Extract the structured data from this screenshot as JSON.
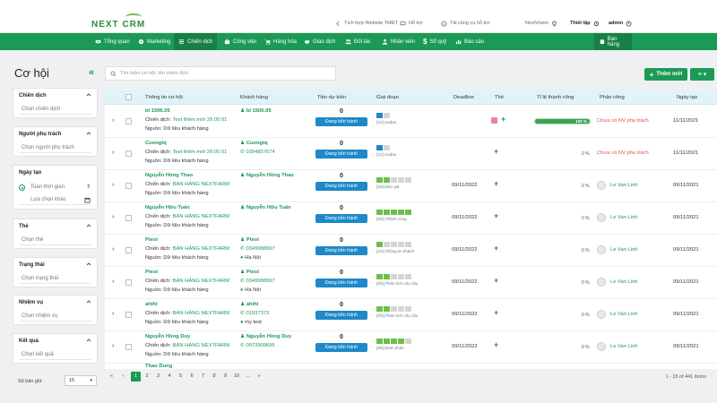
{
  "brand": {
    "name": "NEXT CRM"
  },
  "topbar": {
    "link1": "Tích hợp Website TMĐT",
    "link2": "Hỗ trợ",
    "link3": "Tải công cụ hỗ trợ",
    "org": "NextVision",
    "settings": "Thiết lập",
    "user": "admin"
  },
  "nav": [
    "Tổng quan",
    "Marketing",
    "Chiến dịch",
    "Công việc",
    "Hàng hóa",
    "Giao dịch",
    "Đối tác",
    "Nhân viên",
    "Sổ quỹ",
    "Báo cáo"
  ],
  "nav_right": "Bán hàng",
  "page": {
    "title": "Cơ hội"
  },
  "search": {
    "placeholder": "Tìm kiếm cơ hội, tên chiến dịch"
  },
  "actions": {
    "add": "Thêm mới",
    "menu": "≡ ▾"
  },
  "filters": {
    "campaign": {
      "title": "Chiến dịch",
      "placeholder": "Chọn chiến dịch"
    },
    "owner": {
      "title": "Người phụ trách",
      "placeholder": "Chọn người phụ trách"
    },
    "created": {
      "title": "Ngày tạo",
      "opt_all": "Toàn thời gian",
      "opt_custom": "Lựa chọn khác"
    },
    "tags": {
      "title": "Thẻ",
      "placeholder": "Chọn thẻ"
    },
    "status": {
      "title": "Trạng thái",
      "placeholder": "Chọn trạng thái"
    },
    "task": {
      "title": "Nhiệm vụ",
      "placeholder": "Chọn nhiệm vụ"
    },
    "result": {
      "title": "Kết quả",
      "placeholder": "Chọn kết quả"
    }
  },
  "columns": [
    "Thông tin cơ hội",
    "Khách hàng",
    "Tiền dự kiến",
    "Giai đoạn",
    "Deadline",
    "Thẻ",
    "Tỉ lệ thành công",
    "Phân công",
    "Ngày tạo"
  ],
  "rows": [
    {
      "name": "bl 1506.05",
      "campaign_label": "Chiến dịch:",
      "campaign": "Test thêm mới 29.05 01",
      "source": "Nguồn: Dữ liệu khách hàng",
      "customer": "bl 1506.05",
      "phone": "",
      "address": "",
      "amount": "0",
      "status": "Đang tiến hành",
      "stage_label": "[1/2] sadsa",
      "stage_done": 1,
      "stage_total": 2,
      "deadline": "",
      "tag": true,
      "rate": 100,
      "rate_text": "100 %",
      "assignee": "Chưa có NV phụ trách",
      "assigned": false,
      "created": "11/11/2021"
    },
    {
      "name": "Cuongtq",
      "campaign_label": "Chiến dịch:",
      "campaign": "Test thêm mới 29.05 01",
      "source": "Nguồn: Dữ liệu khách hàng",
      "customer": "Cuongtq",
      "phone": "0394857674",
      "address": "",
      "amount": "0",
      "status": "Đang tiến hành",
      "stage_label": "[1/2] sadsa",
      "stage_done": 1,
      "stage_total": 2,
      "deadline": "",
      "tag": false,
      "rate": 0,
      "rate_text": "0 %",
      "assignee": "Chưa có NV phụ trách",
      "assigned": false,
      "created": "11/11/2021"
    },
    {
      "name": "Nguyễn Hồng Thao",
      "campaign_label": "Chiến dịch:",
      "campaign": "BÁN HÀNG NEXTFARM",
      "source": "Nguồn: Dữ liệu khách hàng",
      "customer": "Nguyễn Hồng Thao",
      "phone": "",
      "address": "",
      "amount": "0",
      "status": "Đang tiến hành",
      "stage_label": "[2/5] Báo giá",
      "stage_done": 2,
      "stage_total": 5,
      "deadline": "09/11/2022",
      "tag": false,
      "rate": 0,
      "rate_text": "0 %",
      "assignee": "Le Van Linh",
      "assigned": true,
      "created": "09/11/2021"
    },
    {
      "name": "Nguyễn Hữu Tuấn",
      "campaign_label": "Chiến dịch:",
      "campaign": "BÁN HÀNG NEXTFARM",
      "source": "Nguồn: Dữ liệu khách hàng",
      "customer": "Nguyễn Hữu Tuấn",
      "phone": "",
      "address": "",
      "amount": "0",
      "status": "Đang tiến hành",
      "stage_label": "[5/5] Thành công",
      "stage_done": 5,
      "stage_total": 5,
      "deadline": "09/11/2022",
      "tag": false,
      "rate": 0,
      "rate_text": "0 %",
      "assignee": "Le Van Linh",
      "assigned": true,
      "created": "09/11/2021"
    },
    {
      "name": "Ptest",
      "campaign_label": "Chiến dịch:",
      "campaign": "BÁN HÀNG NEXTFARM",
      "source": "Nguồn: Dữ liệu khách hàng",
      "customer": "Ptest",
      "phone": "0349988997",
      "address": "Hà Nội",
      "amount": "0",
      "status": "Đang tiến hành",
      "stage_label": "[1/5] Thông tin khách",
      "stage_done": 1,
      "stage_total": 5,
      "deadline": "09/11/2022",
      "tag": false,
      "rate": 0,
      "rate_text": "0 %",
      "assignee": "Le Van Linh",
      "assigned": true,
      "created": "09/11/2021"
    },
    {
      "name": "Ptest",
      "campaign_label": "Chiến dịch:",
      "campaign": "BÁN HÀNG NEXTFARM",
      "source": "Nguồn: Dữ liệu khách hàng",
      "customer": "Ptest",
      "phone": "0349988997",
      "address": "Hà Nội",
      "amount": "0",
      "status": "Đang tiến hành",
      "stage_label": "[2/5] Phân tích nhu cầu",
      "stage_done": 2,
      "stage_total": 5,
      "deadline": "09/11/2022",
      "tag": false,
      "rate": 0,
      "rate_text": "0 %",
      "assignee": "Le Van Linh",
      "assigned": true,
      "created": "09/11/2021"
    },
    {
      "name": "ahihi",
      "campaign_label": "Chiến dịch:",
      "campaign": "BÁN HÀNG NEXTFARM",
      "source": "Nguồn: Dữ liệu khách hàng",
      "customer": "ahihi",
      "phone": "01937373",
      "address": "my test",
      "amount": "0",
      "status": "Đang tiến hành",
      "stage_label": "[2/5] Phân tích nhu cầu",
      "stage_done": 2,
      "stage_total": 5,
      "deadline": "09/11/2022",
      "tag": false,
      "rate": 0,
      "rate_text": "0 %",
      "assignee": "Le Van Linh",
      "assigned": true,
      "created": "09/11/2021"
    },
    {
      "name": "Nguyễn Hồng Duy",
      "campaign_label": "Chiến dịch:",
      "campaign": "BÁN HÀNG NEXTFARM",
      "source": "Nguồn: Dữ liệu khách hàng",
      "customer": "Nguyễn Hồng Duy",
      "phone": "0973909695",
      "address": "",
      "amount": "0",
      "status": "Đang tiến hành",
      "stage_label": "[4/5] Đàm phán",
      "stage_done": 4,
      "stage_total": 5,
      "deadline": "09/11/2022",
      "tag": false,
      "rate": 0,
      "rate_text": "0 %",
      "assignee": "Le Van Linh",
      "assigned": true,
      "created": "09/11/2021"
    }
  ],
  "partial_row": "Thao Dung",
  "pagination": {
    "pages": [
      "1",
      "2",
      "3",
      "4",
      "5",
      "6",
      "7",
      "8",
      "9",
      "10",
      "...",
      "»"
    ],
    "info": "1 - 15 of 441 items"
  },
  "page_size": {
    "label": "Số bản ghi:",
    "value": "15"
  }
}
